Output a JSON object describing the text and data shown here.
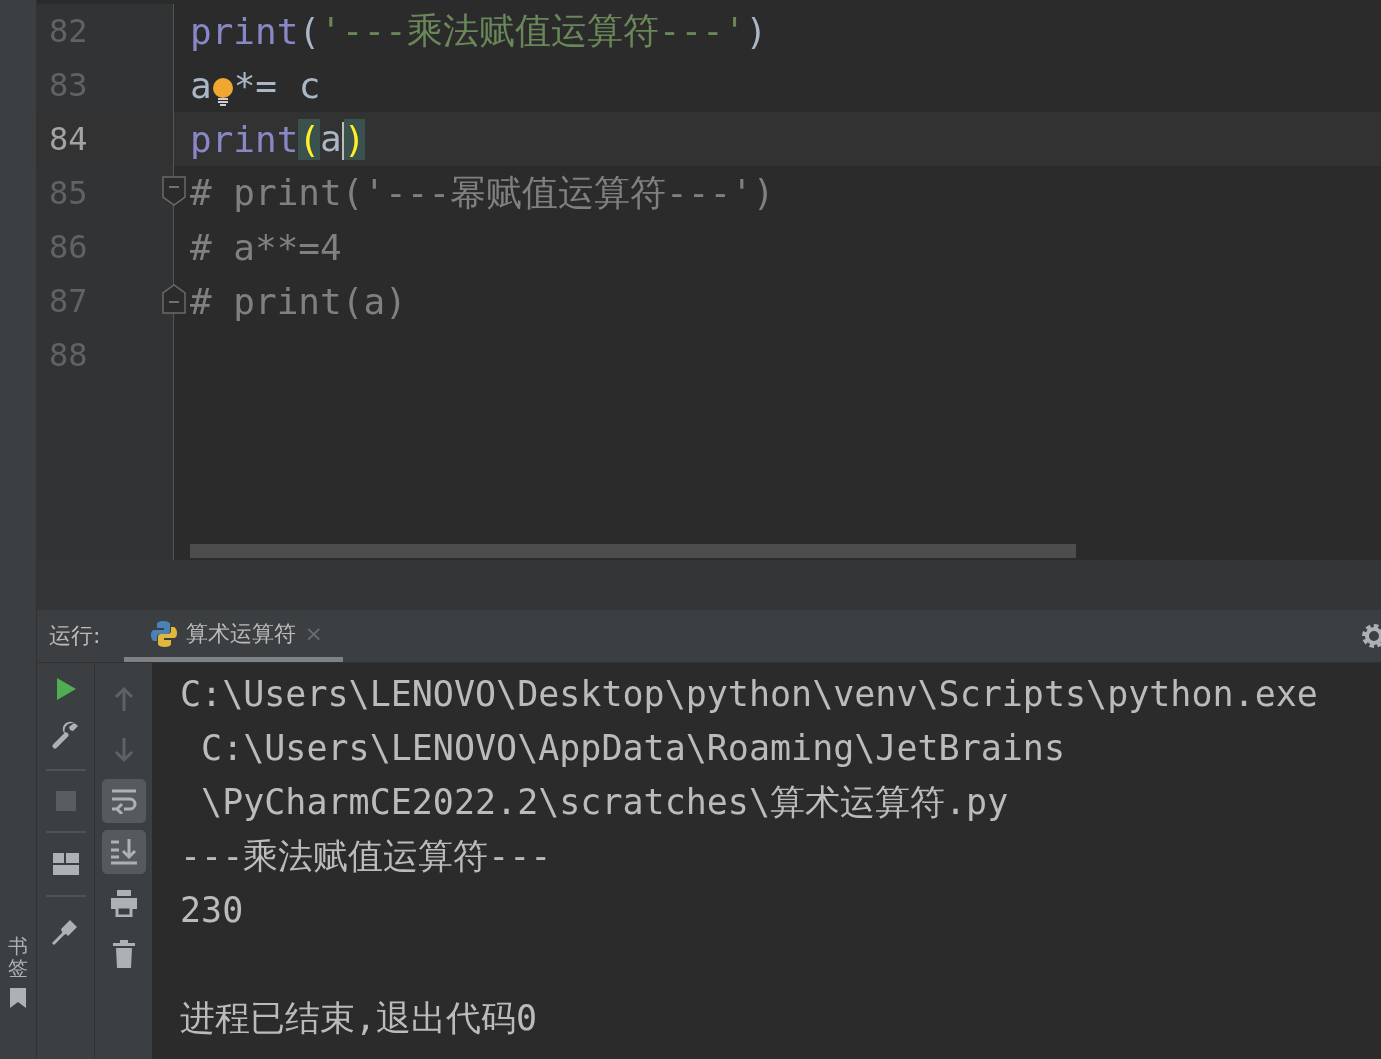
{
  "left_strip": {
    "label": "书签"
  },
  "editor": {
    "lines": [
      {
        "number": "82",
        "selected": false,
        "fold_start": false,
        "fold_end": false,
        "bulb": false,
        "tokens": [
          {
            "kind": "keyword",
            "text": "print",
            "caret": false
          },
          {
            "kind": "plain",
            "text": "(",
            "caret": false
          },
          {
            "kind": "string",
            "text": "'---乘法赋值运算符---'",
            "caret": false
          },
          {
            "kind": "plain",
            "text": ")",
            "caret": false
          }
        ]
      },
      {
        "number": "83",
        "selected": false,
        "fold_start": false,
        "fold_end": false,
        "bulb": true,
        "tokens": [
          {
            "kind": "plain",
            "text": "a",
            "caret": false
          },
          {
            "kind": "plain",
            "text": "*= c",
            "caret": false
          }
        ]
      },
      {
        "number": "84",
        "selected": true,
        "fold_start": false,
        "fold_end": false,
        "bulb": false,
        "tokens": [
          {
            "kind": "keyword",
            "text": "print",
            "caret": false
          },
          {
            "kind": "brace",
            "text": "(",
            "caret": false
          },
          {
            "kind": "plain",
            "text": "a",
            "caret": true
          },
          {
            "kind": "brace",
            "text": ")",
            "caret": false
          }
        ]
      },
      {
        "number": "85",
        "selected": false,
        "fold_start": true,
        "fold_end": false,
        "bulb": false,
        "tokens": [
          {
            "kind": "comment",
            "text": "# print('---幂赋值运算符---')",
            "caret": false
          }
        ]
      },
      {
        "number": "86",
        "selected": false,
        "fold_start": false,
        "fold_end": false,
        "bulb": false,
        "tokens": [
          {
            "kind": "comment",
            "text": "# a**=4",
            "caret": false
          }
        ]
      },
      {
        "number": "87",
        "selected": false,
        "fold_start": false,
        "fold_end": true,
        "bulb": false,
        "tokens": [
          {
            "kind": "comment",
            "text": "# print(a)",
            "caret": false
          }
        ]
      },
      {
        "number": "88",
        "selected": false,
        "fold_start": false,
        "fold_end": false,
        "bulb": false
      }
    ]
  },
  "run_panel": {
    "label": "运行:",
    "tabs": [
      {
        "title": "算术运算符",
        "close": "×",
        "selected": true
      }
    ],
    "toolbar_left": [
      {
        "kind": "run"
      },
      {
        "kind": "wrench"
      },
      {
        "kind": "separator"
      },
      {
        "kind": "stop"
      },
      {
        "kind": "separator"
      },
      {
        "kind": "layout"
      },
      {
        "kind": "separator"
      },
      {
        "kind": "pin"
      }
    ],
    "toolbar_right": [
      {
        "kind": "up",
        "selected": false
      },
      {
        "kind": "down",
        "selected": false
      },
      {
        "kind": "wrap",
        "selected": true
      },
      {
        "kind": "scroll-end",
        "selected": true
      },
      {
        "kind": "print",
        "selected": false
      },
      {
        "kind": "trash",
        "selected": false
      }
    ],
    "console": {
      "lines": [
        "C:\\Users\\LENOVO\\Desktop\\python\\venv\\Scripts\\python.exe",
        " C:\\Users\\LENOVO\\AppData\\Roaming\\JetBrains",
        " \\PyCharmCE2022.2\\scratches\\算术运算符.py",
        "---乘法赋值运算符---",
        "230"
      ],
      "exit_message": "进程已结束,退出代码0"
    }
  }
}
